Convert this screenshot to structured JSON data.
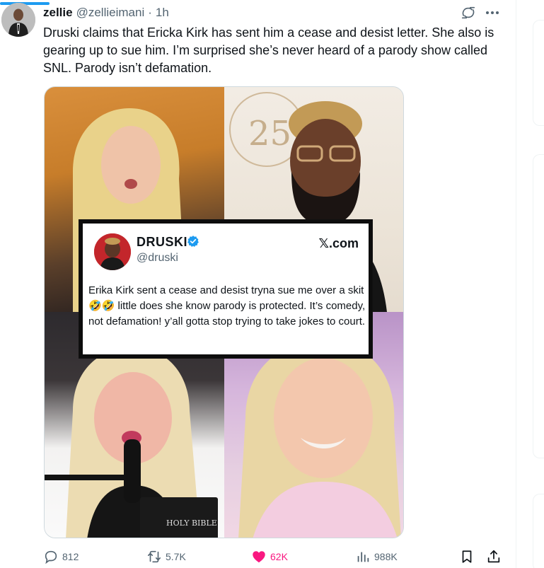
{
  "author": {
    "display_name": "zellie",
    "handle": "@zellieimani",
    "separator": "·",
    "time": "1h"
  },
  "tweet_text": "Druski claims that Ericka Kirk has sent him a cease and desist letter. She also is gearing up to sue him. I’m surprised she’s never heard of a parody show called SNL. Parody isn’t defamation.",
  "media": {
    "embedded_post": {
      "name": "DRUSKI",
      "handle": "@druski",
      "site": "𝕏.com",
      "text": "Erika Kirk sent a cease and desist tryna sue me over a skit 🤣🤣 little does she know parody is protected. It’s comedy, not defamation! y’all gotta stop trying to take jokes to court."
    },
    "photo_text": {
      "anniversary": "25",
      "bible": "HOLY BIBLE"
    }
  },
  "actions": {
    "replies": "812",
    "reposts": "5.7K",
    "likes": "62K",
    "views": "988K"
  },
  "colors": {
    "accent": "#1d9bf0",
    "like": "#f91880",
    "muted": "#536471"
  }
}
